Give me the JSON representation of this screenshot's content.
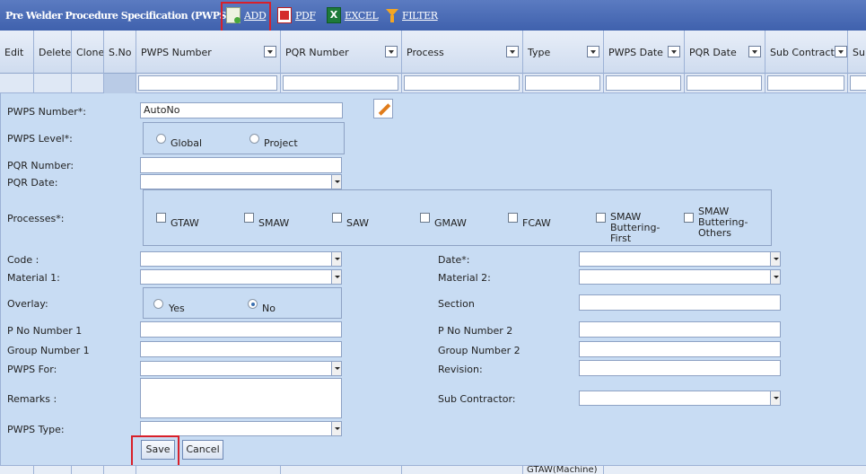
{
  "toolbar": {
    "title": "Pre Welder Procedure Specification (PWPS)",
    "add_label": "ADD",
    "pdf_label": "PDF",
    "excel_label": "EXCEL",
    "filter_label": "FILTER"
  },
  "grid": {
    "columns": [
      "Edit",
      "Delete",
      "Clone",
      "S.No",
      "PWPS Number",
      "PQR Number",
      "Process",
      "Type",
      "PWPS Date",
      "PQR Date",
      "Sub Contractor",
      "Su"
    ]
  },
  "form": {
    "pwps_number_label": "PWPS Number*:",
    "pwps_number_value": "AutoNo",
    "pwps_level_label": "PWPS Level*:",
    "level_global": "Global",
    "level_project": "Project",
    "pqr_number_label": "PQR Number:",
    "pqr_date_label": "PQR Date:",
    "processes_label": "Processes*:",
    "processes": [
      "GTAW",
      "SMAW",
      "SAW",
      "GMAW",
      "FCAW"
    ],
    "proc_smaw_bf": "SMAW Buttering-First",
    "proc_smaw_bo": "SMAW Buttering-Others",
    "code_label": "Code :",
    "material1_label": "Material 1:",
    "overlay_label": "Overlay:",
    "overlay_yes": "Yes",
    "overlay_no": "No",
    "overlay_selected": "No",
    "pno1_label": "P No Number 1",
    "group1_label": "Group Number 1",
    "pwps_for_label": "PWPS For:",
    "remarks_label": "Remarks :",
    "pwps_type_label": "PWPS Type:",
    "date_label": "Date*:",
    "material2_label": "Material 2:",
    "section_label": "Section",
    "pno2_label": "P No Number 2",
    "group2_label": "Group Number 2",
    "revision_label": "Revision:",
    "sub_contractor_label": "Sub Contractor:",
    "save_label": "Save",
    "cancel_label": "Cancel"
  },
  "bottom_row": {
    "process_cell": "GTAW(Machine)"
  },
  "colors": {
    "titlebar": "#4a6bb5",
    "form_bg": "#c8dcf3",
    "highlight": "#d8202a"
  }
}
